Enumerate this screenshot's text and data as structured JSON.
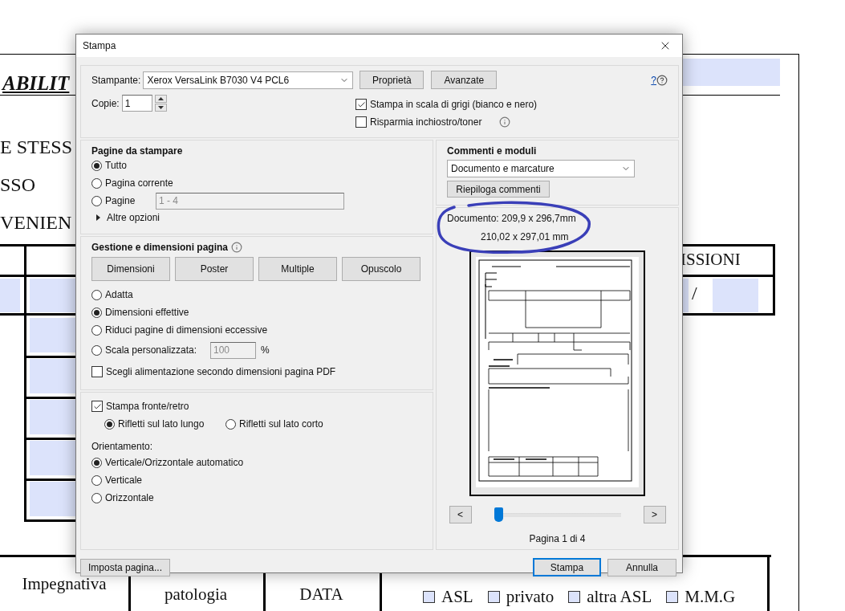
{
  "document": {
    "title": "ABILIT",
    "lines": [
      "E STESS",
      "SSO",
      "VENIEN"
    ],
    "column_header": "ISSIONI",
    "date_separator": "/",
    "bottom_headers": [
      "Impegnativa",
      "patologia",
      "DATA"
    ],
    "referrer_options": [
      {
        "label": "ASL",
        "checked": false
      },
      {
        "label": "privato",
        "checked": false
      },
      {
        "label": "altra ASL",
        "checked": false
      },
      {
        "label": "M.M.G",
        "checked": false
      }
    ]
  },
  "dialog": {
    "title": "Stampa",
    "printer": {
      "label": "Stampante:",
      "value": "Xerox VersaLink B7030 V4 PCL6"
    },
    "printer_buttons": [
      "Proprietà",
      "Avanzate"
    ],
    "help_link": "?",
    "copies": {
      "label": "Copie:",
      "value": "1"
    },
    "print_options": [
      {
        "label": "Stampa in scala di grigi (bianco e nero)",
        "checked": true,
        "info": false
      },
      {
        "label": "Risparmia inchiostro/toner",
        "checked": false,
        "info": true
      }
    ],
    "pages": {
      "title": "Pagine da stampare",
      "options": [
        {
          "label": "Tutto",
          "selected": true
        },
        {
          "label": "Pagina corrente",
          "selected": false
        },
        {
          "label": "Pagine",
          "selected": false,
          "range": "1 - 4",
          "disabled": true
        }
      ],
      "more": "Altre opzioni"
    },
    "page_handling": {
      "title": "Gestione e dimensioni pagina",
      "modes": [
        "Dimensioni",
        "Poster",
        "Multiple",
        "Opuscolo"
      ],
      "scaling": [
        {
          "label": "Adatta",
          "selected": false
        },
        {
          "label": "Dimensioni effettive",
          "selected": true
        },
        {
          "label": "Riduci pagine di dimensioni eccessive",
          "selected": false
        },
        {
          "label": "Scala personalizzata:",
          "selected": false,
          "value": "100",
          "unit": "%",
          "disabled": true
        }
      ],
      "paper_source": {
        "label": "Scegli alimentazione secondo dimensioni pagina PDF",
        "checked": false
      }
    },
    "duplex": {
      "label": "Stampa fronte/retro",
      "checked": true,
      "flip": [
        {
          "label": "Rifletti sul lato lungo",
          "selected": true
        },
        {
          "label": "Rifletti sul lato corto",
          "selected": false
        }
      ]
    },
    "orientation": {
      "title": "Orientamento:",
      "options": [
        {
          "label": "Verticale/Orizzontale automatico",
          "selected": true
        },
        {
          "label": "Verticale",
          "selected": false
        },
        {
          "label": "Orizzontale",
          "selected": false
        }
      ]
    },
    "comments": {
      "title": "Commenti e moduli",
      "value": "Documento e marcature",
      "button": "Riepiloga commenti"
    },
    "preview": {
      "document_size": "Documento: 209,9 x 296,7mm",
      "paper_size": "210,02 x 297,01 mm",
      "prev": "<",
      "next": ">",
      "slider": {
        "level": 0
      },
      "page_label": "Pagina 1 di 4"
    },
    "footer": {
      "setup": "Imposta pagina...",
      "print": "Stampa",
      "cancel": "Annulla"
    }
  }
}
